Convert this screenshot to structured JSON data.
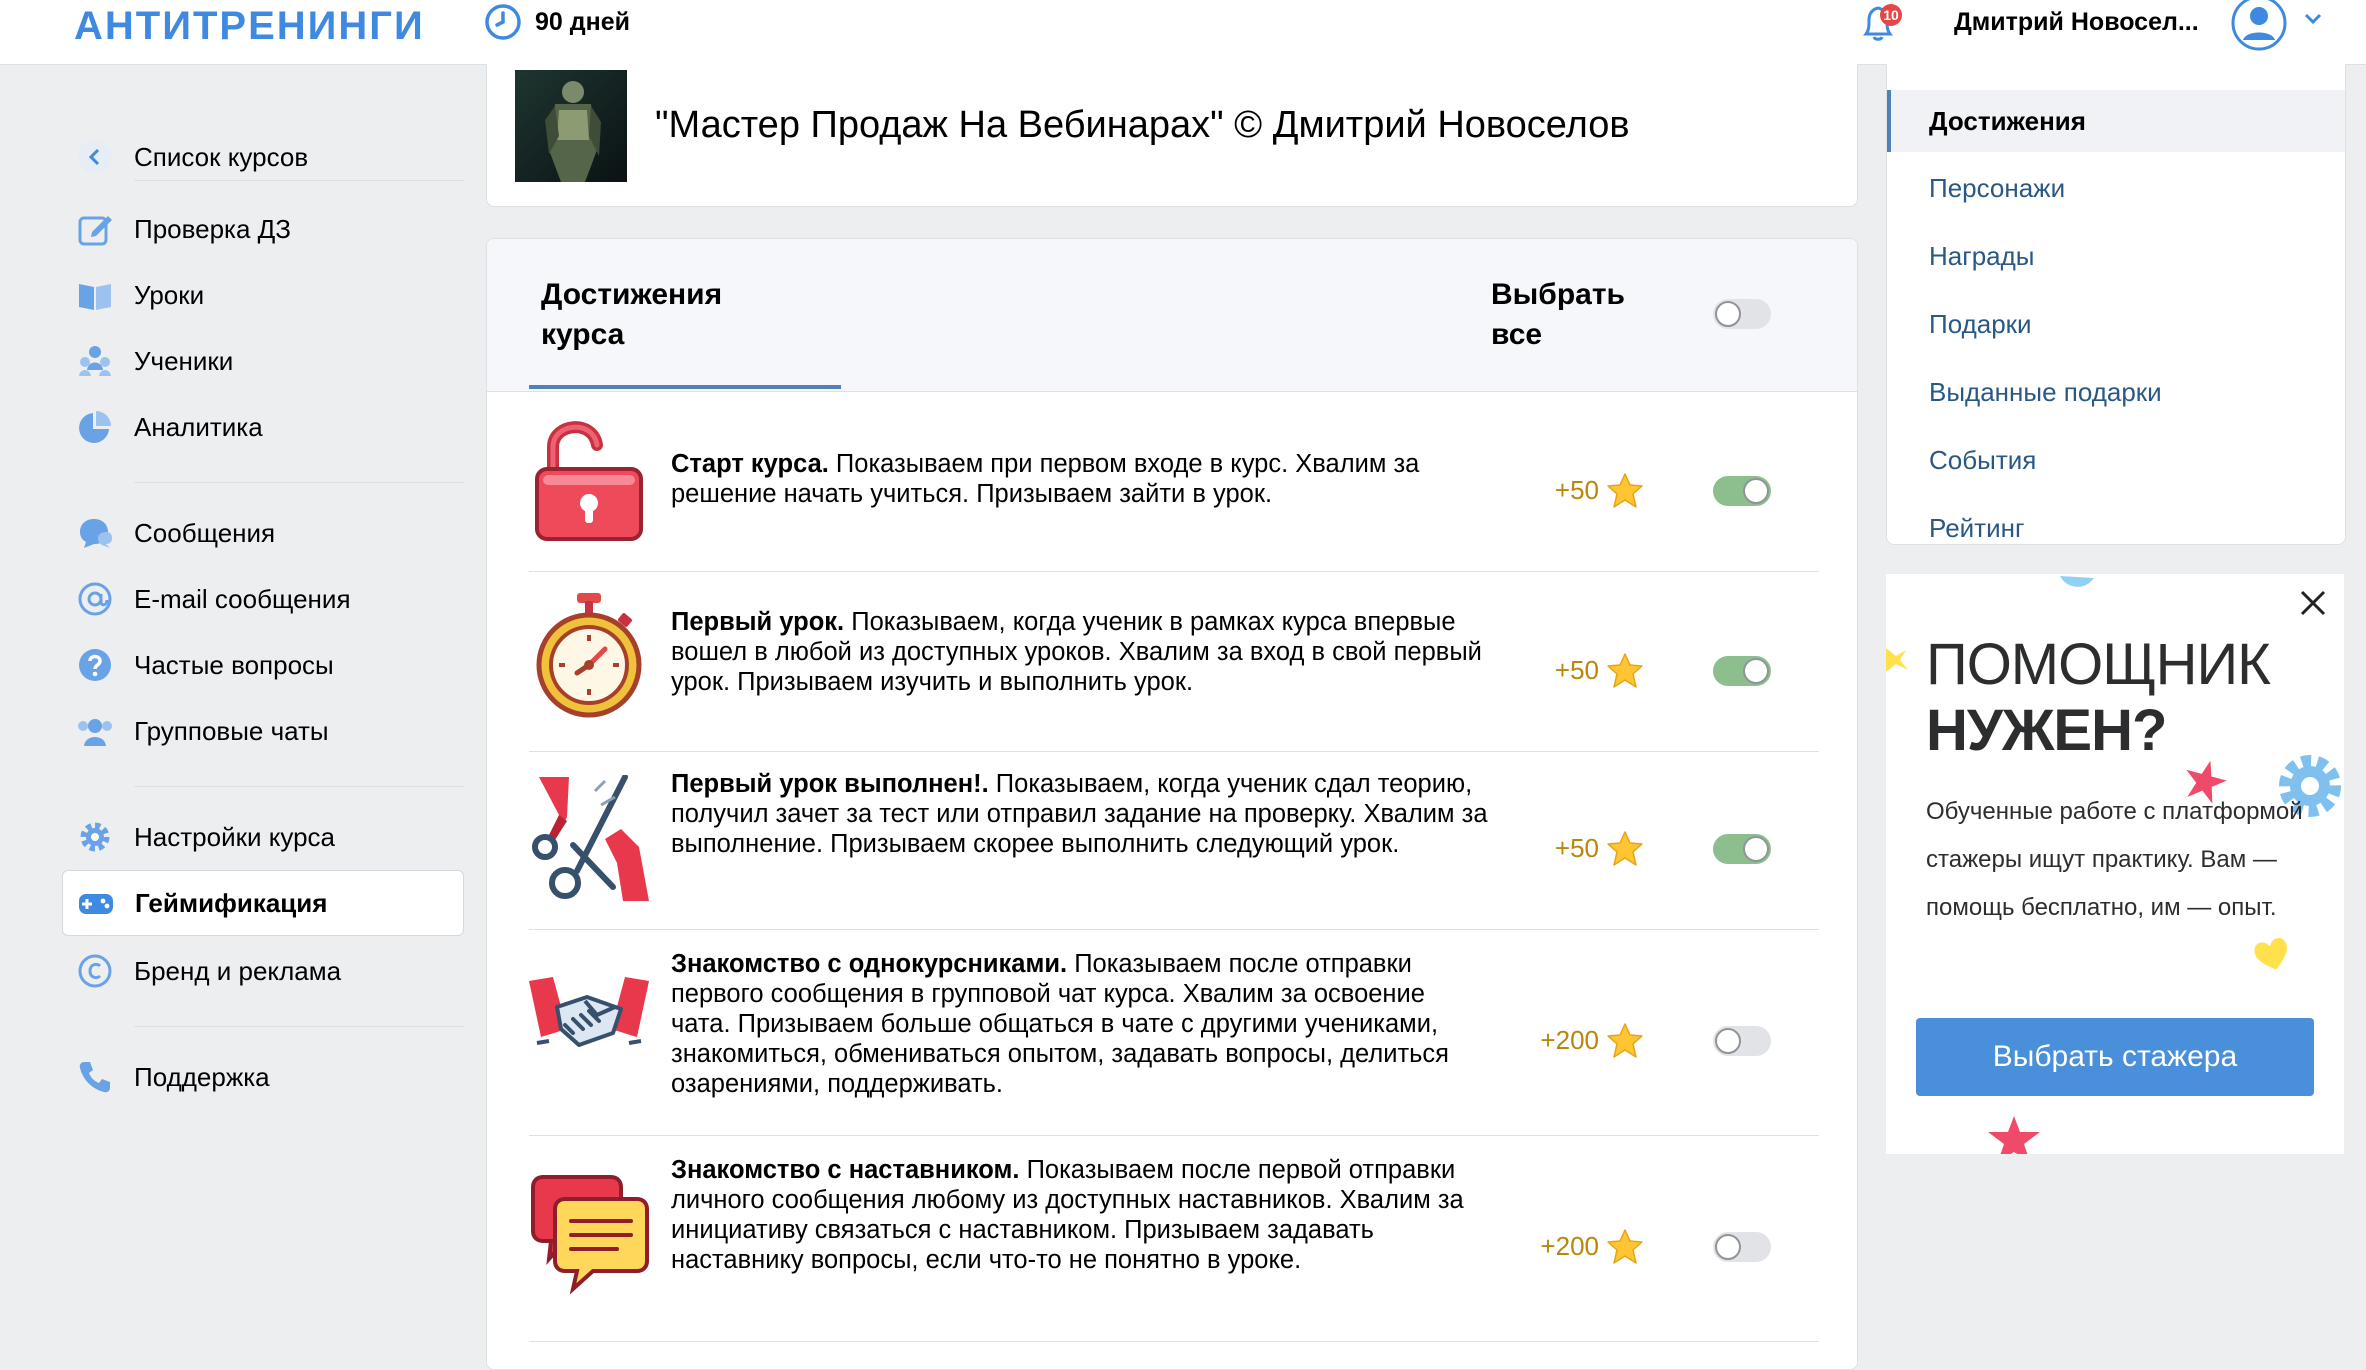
{
  "header": {
    "logo": "АНТИТРЕНИНГИ",
    "duration": "90 дней",
    "notifications_count": "10",
    "username": "Дмитрий Новосел..."
  },
  "sidebar": {
    "back": "Список курсов",
    "items": [
      {
        "label": "Проверка ДЗ",
        "icon": "edit-icon"
      },
      {
        "label": "Уроки",
        "icon": "book-icon"
      },
      {
        "label": "Ученики",
        "icon": "students-icon"
      },
      {
        "label": "Аналитика",
        "icon": "pie-chart-icon"
      },
      {
        "label": "Сообщения",
        "icon": "chat-icon"
      },
      {
        "label": "E-mail сообщения",
        "icon": "at-icon"
      },
      {
        "label": "Частые вопросы",
        "icon": "question-icon"
      },
      {
        "label": "Групповые чаты",
        "icon": "group-icon"
      },
      {
        "label": "Настройки курса",
        "icon": "gear-icon"
      },
      {
        "label": "Геймификация",
        "icon": "gamepad-icon",
        "active": true
      },
      {
        "label": "Бренд и реклама",
        "icon": "copyright-icon"
      },
      {
        "label": "Поддержка",
        "icon": "phone-icon"
      }
    ]
  },
  "course": {
    "title": "\"Мастер Продаж На Вебинарах\" © Дмитрий Новоселов"
  },
  "achievements": {
    "tab_label": "Достижения курса",
    "select_all_label": "Выбрать все",
    "select_all_on": false,
    "items": [
      {
        "title": "Старт курса.",
        "text": " Показываем при первом входе в курс. Хвалим за решение начать учиться. Призываем зайти в урок.",
        "points": "+50",
        "enabled": true,
        "icon": "unlocked-padlock-icon"
      },
      {
        "title": "Первый урок.",
        "text": " Показываем, когда ученик в рамках курса впервые вошел в любой из доступных уроков. Хвалим за вход в свой первый урок. Призываем изучить и выполнить урок.",
        "points": "+50",
        "enabled": true,
        "icon": "stopwatch-icon"
      },
      {
        "title": "Первый урок выполнен!.",
        "text": " Показываем, когда ученик сдал теорию, получил зачет за тест или отправил задание на проверку. Хвалим за выполнение. Призываем скорее выполнить следующий урок.",
        "points": "+50",
        "enabled": true,
        "icon": "ribbon-scissors-icon"
      },
      {
        "title": "Знакомство с однокурсниками.",
        "text": " Показываем после отправки первого сообщения в групповой чат курса. Хвалим за освоение чата. Призываем больше общаться в чате с другими учениками, знакомиться, обмениваться опытом, задавать вопросы, делиться озарениями, поддерживать.",
        "points": "+200",
        "enabled": false,
        "icon": "handshake-icon"
      },
      {
        "title": "Знакомство с наставником.",
        "text": " Показываем после первой отправки личного сообщения любому из доступных наставников. Хвалим за инициативу связаться с наставником. Призываем задавать наставнику вопросы, если что-то не понятно в уроке.",
        "points": "+200",
        "enabled": false,
        "icon": "speech-bubbles-icon"
      }
    ]
  },
  "right_menu": {
    "items": [
      "Достижения",
      "Персонажи",
      "Награды",
      "Подарки",
      "Выданные подарки",
      "События",
      "Рейтинг"
    ]
  },
  "promo": {
    "title_line1": "ПОМОЩНИК",
    "title_line2": "НУЖЕН?",
    "text": "Обученные работе с платформой стажеры ищут практику. Вам — помощь бесплатно, им — опыт.",
    "button": "Выбрать стажера"
  },
  "colors": {
    "accent": "#3f8ae0",
    "link": "#2a5885",
    "toggle_on": "#8cbf8d",
    "points": "#b8860b",
    "promo_button": "#4a8fd9"
  }
}
